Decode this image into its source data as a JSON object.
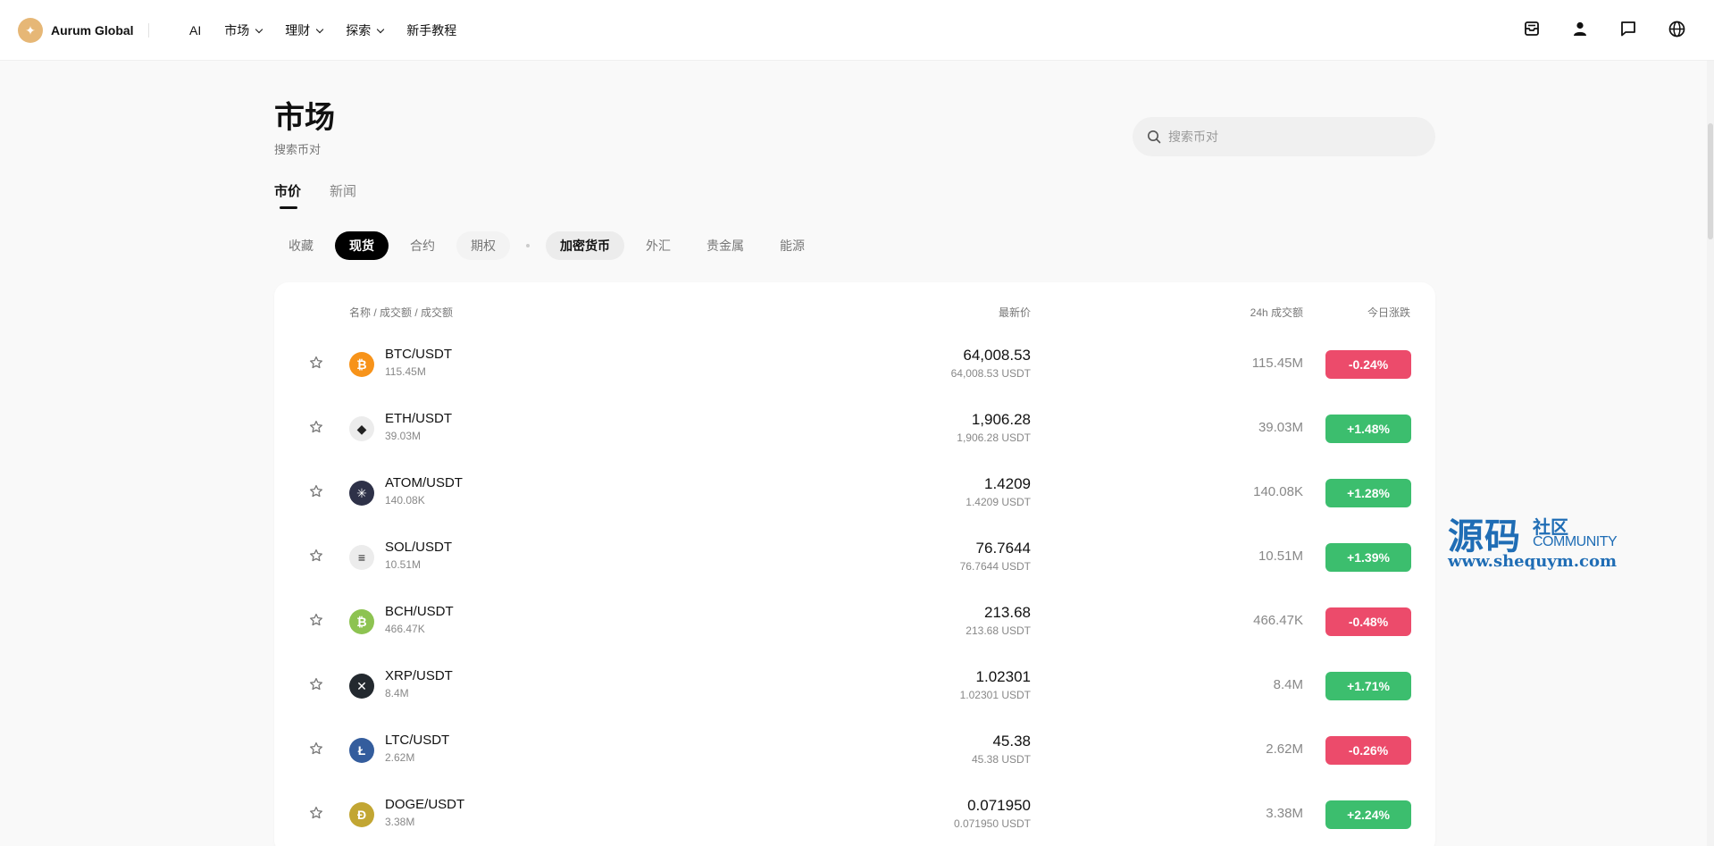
{
  "header": {
    "brand_name": "Aurum Global",
    "nav": [
      {
        "label": "AI",
        "has_dropdown": false
      },
      {
        "label": "市场",
        "has_dropdown": true
      },
      {
        "label": "理财",
        "has_dropdown": true
      },
      {
        "label": "探索",
        "has_dropdown": true
      },
      {
        "label": "新手教程",
        "has_dropdown": false
      }
    ],
    "icons": [
      "inbox-icon",
      "user-icon",
      "chat-icon",
      "globe-icon"
    ]
  },
  "page": {
    "title": "市场",
    "subtitle": "搜索币对",
    "search_placeholder": "搜索币对",
    "view_tabs": [
      {
        "label": "市价",
        "active": true
      },
      {
        "label": "新闻",
        "active": false
      }
    ],
    "market_filters": [
      "收藏",
      "现货",
      "合约",
      "期权"
    ],
    "active_market_filter": "现货",
    "asset_filters": [
      "加密货币",
      "外汇",
      "贵金属",
      "能源"
    ],
    "active_asset_filter": "加密货币"
  },
  "table": {
    "headers": {
      "name": "名称 / 成交额 / 成交额",
      "price": "最新价",
      "volume": "24h 成交额",
      "change": "今日涨跌"
    },
    "rows": [
      {
        "pair": "BTC/USDT",
        "vol_sub": "115.45M",
        "price": "64,008.53",
        "price_sub": "64,008.53 USDT",
        "vol24": "115.45M",
        "change": "-0.24%",
        "direction": "down",
        "coin_icon": "bitcoin-icon",
        "coin_color": "#f7931a",
        "glyph": "₿"
      },
      {
        "pair": "ETH/USDT",
        "vol_sub": "39.03M",
        "price": "1,906.28",
        "price_sub": "1,906.28 USDT",
        "vol24": "39.03M",
        "change": "+1.48%",
        "direction": "up",
        "coin_icon": "ethereum-icon",
        "coin_color": "#ececec",
        "glyph": "◆"
      },
      {
        "pair": "ATOM/USDT",
        "vol_sub": "140.08K",
        "price": "1.4209",
        "price_sub": "1.4209 USDT",
        "vol24": "140.08K",
        "change": "+1.28%",
        "direction": "up",
        "coin_icon": "cosmos-icon",
        "coin_color": "#2e3148",
        "glyph": "✳"
      },
      {
        "pair": "SOL/USDT",
        "vol_sub": "10.51M",
        "price": "76.7644",
        "price_sub": "76.7644 USDT",
        "vol24": "10.51M",
        "change": "+1.39%",
        "direction": "up",
        "coin_icon": "solana-icon",
        "coin_color": "#ececec",
        "glyph": "≡"
      },
      {
        "pair": "BCH/USDT",
        "vol_sub": "466.47K",
        "price": "213.68",
        "price_sub": "213.68 USDT",
        "vol24": "466.47K",
        "change": "-0.48%",
        "direction": "down",
        "coin_icon": "bitcoin-cash-icon",
        "coin_color": "#8dc351",
        "glyph": "₿"
      },
      {
        "pair": "XRP/USDT",
        "vol_sub": "8.4M",
        "price": "1.02301",
        "price_sub": "1.02301 USDT",
        "vol24": "8.4M",
        "change": "+1.71%",
        "direction": "up",
        "coin_icon": "xrp-icon",
        "coin_color": "#23292f",
        "glyph": "✕"
      },
      {
        "pair": "LTC/USDT",
        "vol_sub": "2.62M",
        "price": "45.38",
        "price_sub": "45.38 USDT",
        "vol24": "2.62M",
        "change": "-0.26%",
        "direction": "down",
        "coin_icon": "litecoin-icon",
        "coin_color": "#345d9d",
        "glyph": "Ł"
      },
      {
        "pair": "DOGE/USDT",
        "vol_sub": "3.38M",
        "price": "0.071950",
        "price_sub": "0.071950 USDT",
        "vol24": "3.38M",
        "change": "+2.24%",
        "direction": "up",
        "coin_icon": "dogecoin-icon",
        "coin_color": "#c2a633",
        "glyph": "Ð"
      }
    ]
  },
  "colors": {
    "up": "#3cbe6e",
    "down": "#ec4b6b",
    "brand": "#e6b776"
  },
  "watermark": {
    "big": "源码",
    "small": "社区",
    "community": "COMMUNITY",
    "url": "www.shequym.com"
  }
}
